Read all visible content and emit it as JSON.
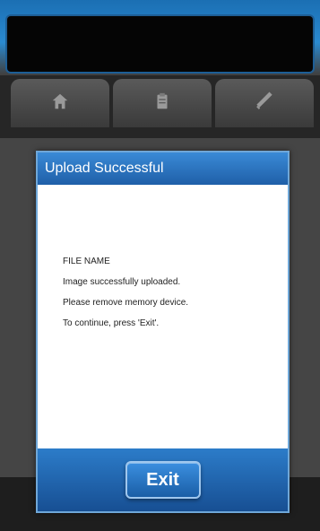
{
  "dialog": {
    "title": "Upload Successful",
    "lines": [
      "FILE NAME",
      "Image successfully uploaded.",
      "Please remove memory device.",
      "To continue, press 'Exit'."
    ],
    "exit_label": "Exit"
  },
  "tabs": [
    {
      "icon": "home-icon"
    },
    {
      "icon": "clipboard-icon"
    },
    {
      "icon": "wrench-icon"
    }
  ],
  "colors": {
    "title_bar": "#2a74c2",
    "footer": "#1f63ad",
    "background": "#454545"
  }
}
